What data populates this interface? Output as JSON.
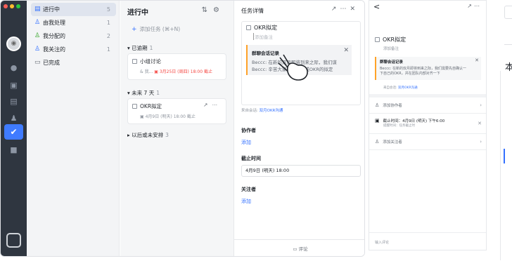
{
  "colors": {
    "rail": "#2f3640",
    "accent": "#3370ff",
    "danger": "#f54a45",
    "quote_bar": "#ffa228"
  },
  "sidebar": {
    "items": [
      {
        "label": "进行中",
        "count": "5",
        "icon": "list-icon"
      },
      {
        "label": "由我处理",
        "count": "1",
        "icon": "person-icon"
      },
      {
        "label": "我分配的",
        "count": "2",
        "icon": "assign-icon"
      },
      {
        "label": "我关注的",
        "count": "1",
        "icon": "follow-icon"
      },
      {
        "label": "已完成",
        "count": "",
        "icon": "archive-icon"
      }
    ]
  },
  "list": {
    "title": "进行中",
    "add_placeholder": "添加任务 (⌘+N)",
    "overdue": {
      "label": "已逾期",
      "count": "1"
    },
    "task1": {
      "title": "小组讨论",
      "assignee": "& 我...",
      "due": "3月25日 (周四) 18:00 截止"
    },
    "next7": {
      "label": "未来 7 天",
      "count": "1"
    },
    "task2": {
      "title": "OKR拟定",
      "due": "4月9日 (明天) 18:00 截止"
    },
    "later": {
      "label": "以后或未安排",
      "count": "3"
    }
  },
  "detail": {
    "header": "任务详情",
    "task_title": "OKR拟定",
    "note_placeholder": "添加备注",
    "quote_title": "群聊会话记录",
    "quote_line1": "Beccc: 在新的双月即将到来之际，我们谋",
    "quote_line2": "Beccc: 辛苦大家在本周完成OKR的拟定",
    "from_prefix": "来自会话:",
    "from_link": "双月OKR沟通",
    "collab_label": "协作者",
    "collab_add": "添加",
    "due_label": "截止时间",
    "due_value": "4月9日 (明天) 18:00",
    "follower_label": "关注者",
    "follower_add": "添加",
    "comment": "评论"
  },
  "mobile": {
    "back": "<",
    "task_title": "OKR拟定",
    "note": "添加备注",
    "quote_title": "群聊会话记录",
    "quote_line1": "Beccc: 在新的双月即将到来之际，我们需要先自确认一",
    "quote_line2": "下自己的OKR，并在团队内部对齐一下",
    "from_prefix": "来自会话:",
    "from_link": "双月OKR沟通",
    "add_collab": "添加协作者",
    "due_title": "截止时间：4月9日 (明天) 下午6:00",
    "due_sub": "提醒时间：任务截止时",
    "add_follower": "添加关注者",
    "comment_input": "输入评论"
  },
  "edge": {
    "char": "本"
  }
}
